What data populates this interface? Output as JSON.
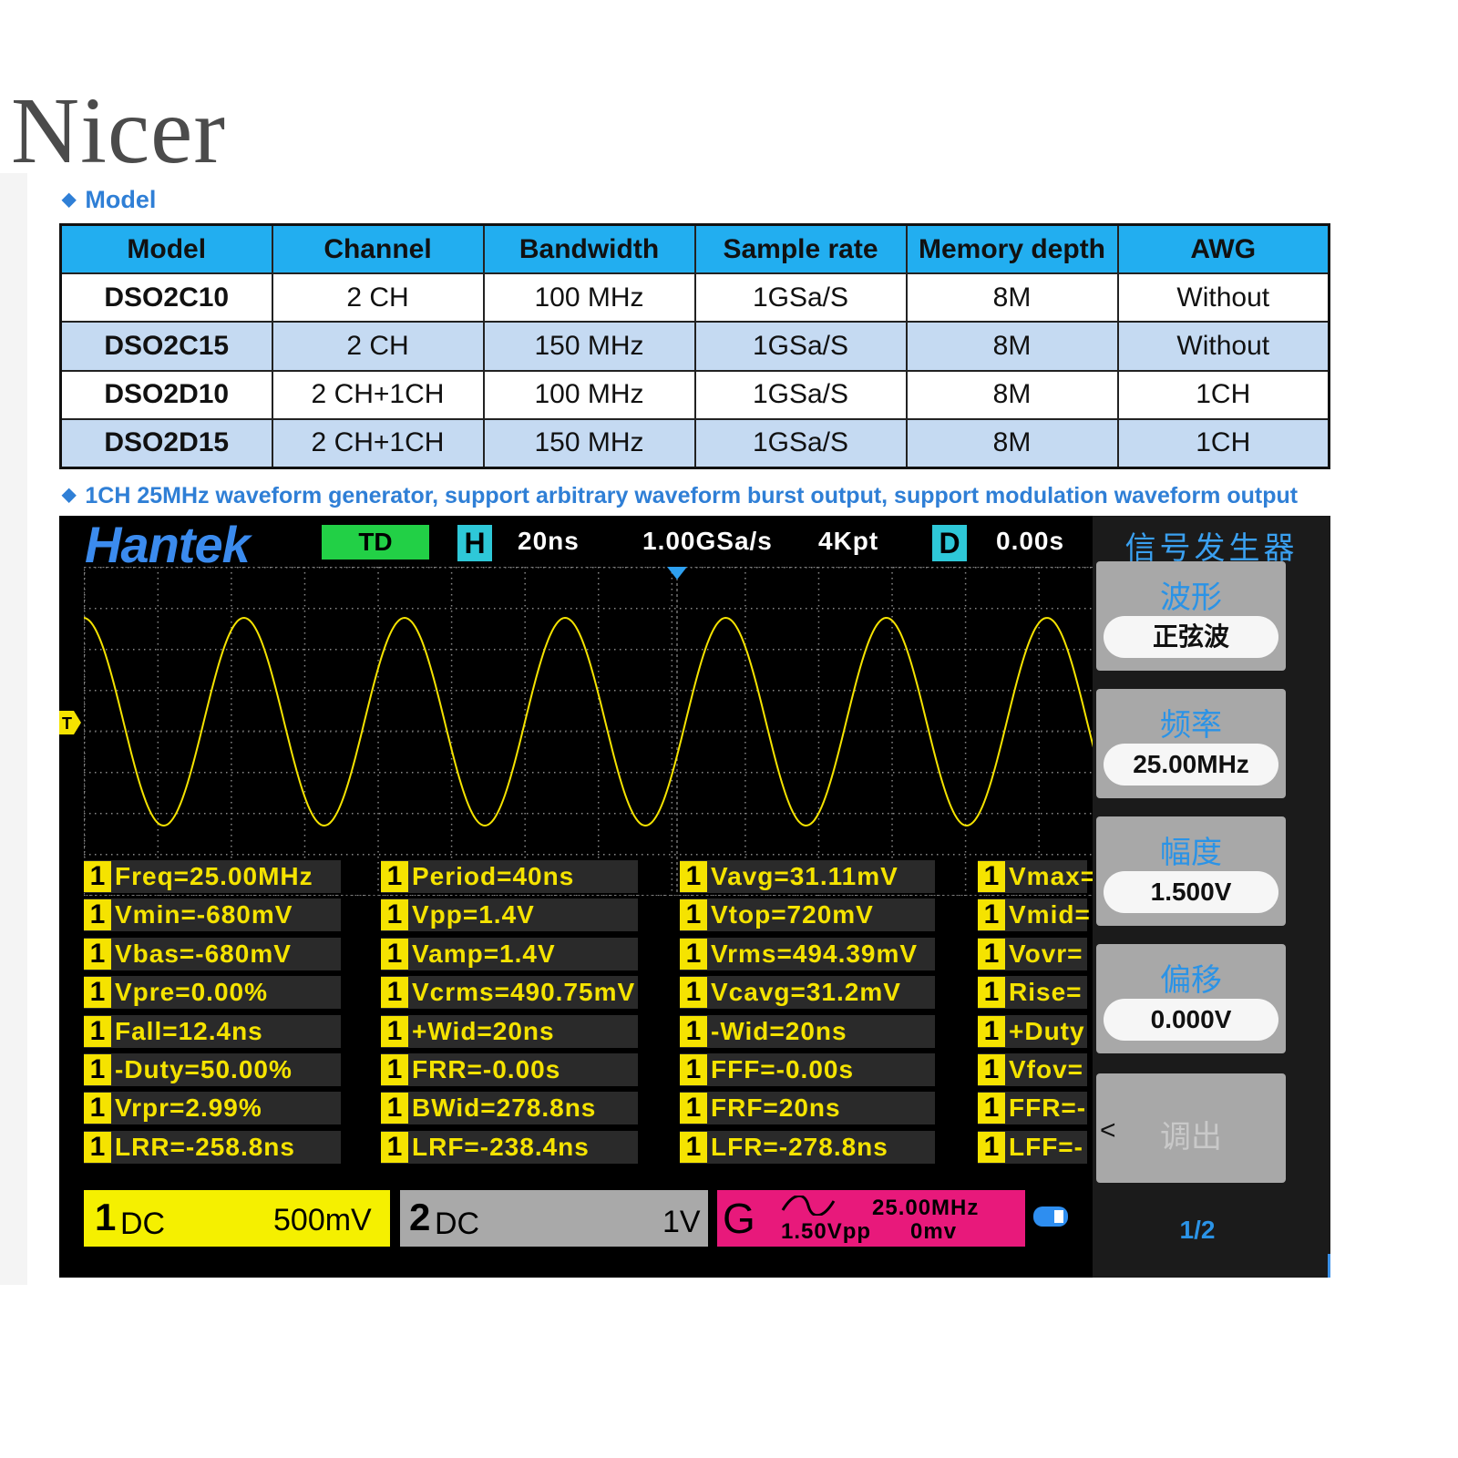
{
  "brand": "Nicer",
  "model_heading": "Model",
  "table": {
    "headers": [
      "Model",
      "Channel",
      "Bandwidth",
      "Sample rate",
      "Memory depth",
      "AWG"
    ],
    "rows": [
      [
        "DSO2C10",
        "2 CH",
        "100 MHz",
        "1GSa/S",
        "8M",
        "Without"
      ],
      [
        "DSO2C15",
        "2 CH",
        "150 MHz",
        "1GSa/S",
        "8M",
        "Without"
      ],
      [
        "DSO2D10",
        "2 CH+1CH",
        "100 MHz",
        "1GSa/S",
        "8M",
        "1CH"
      ],
      [
        "DSO2D15",
        "2 CH+1CH",
        "150 MHz",
        "1GSa/S",
        "8M",
        "1CH"
      ]
    ]
  },
  "awg_heading": "1CH 25MHz waveform generator, support arbitrary waveform burst output, support modulation waveform output",
  "scope": {
    "logo": "Hantek",
    "mode": "TD",
    "h_label": "H",
    "timebase": "20ns",
    "sample_rate": "1.00GSa/s",
    "memory": "4Kpt",
    "d_label": "D",
    "delay": "0.00s",
    "trigger_marker": "T",
    "waveform": {
      "frequency_mhz": 25.0,
      "timebase_ns_per_div": 20,
      "cycles_visible": 6.4
    },
    "measurements": [
      [
        "Freq=25.00MHz",
        "Vmin=-680mV",
        "Vbas=-680mV",
        "Vpre=0.00%",
        "Fall=12.4ns",
        "-Duty=50.00%",
        "Vrpr=2.99%",
        "LRR=-258.8ns"
      ],
      [
        "Period=40ns",
        "Vpp=1.4V",
        "Vamp=1.4V",
        "Vcrms=490.75mV",
        "+Wid=20ns",
        "FRR=-0.00s",
        "BWid=278.8ns",
        "LRF=-238.4ns"
      ],
      [
        "Vavg=31.11mV",
        "Vtop=720mV",
        "Vrms=494.39mV",
        "Vcavg=31.2mV",
        "-Wid=20ns",
        "FFF=-0.00s",
        "FRF=20ns",
        "LFR=-278.8ns"
      ],
      [
        "Vmax=",
        "Vmid=",
        "Vovr=",
        "Rise=",
        "+Duty",
        "Vfov=",
        "FFR=-",
        "LFF=-"
      ]
    ],
    "meas_channel": "1",
    "status": {
      "ch1": {
        "num": "1",
        "coupling": "DC",
        "scale": "500mV"
      },
      "ch2": {
        "num": "2",
        "coupling": "DC",
        "scale": "1V"
      },
      "gen": {
        "label": "G",
        "freq": "25.00MHz",
        "amp": "1.50Vpp",
        "offset": "0mv"
      }
    },
    "menu": {
      "title": "信号发生器",
      "items": [
        {
          "label": "波形",
          "value": "正弦波"
        },
        {
          "label": "频率",
          "value": "25.00MHz"
        },
        {
          "label": "幅度",
          "value": "1.500V"
        },
        {
          "label": "偏移",
          "value": "0.000V"
        }
      ],
      "recall_label": "调出",
      "chevron": "<",
      "page": "1/2"
    }
  },
  "colors": {
    "trace": "#f5e300",
    "table_header": "#22aef0",
    "table_alt_row": "#c5daf2",
    "accent": "#2f7fd6"
  }
}
